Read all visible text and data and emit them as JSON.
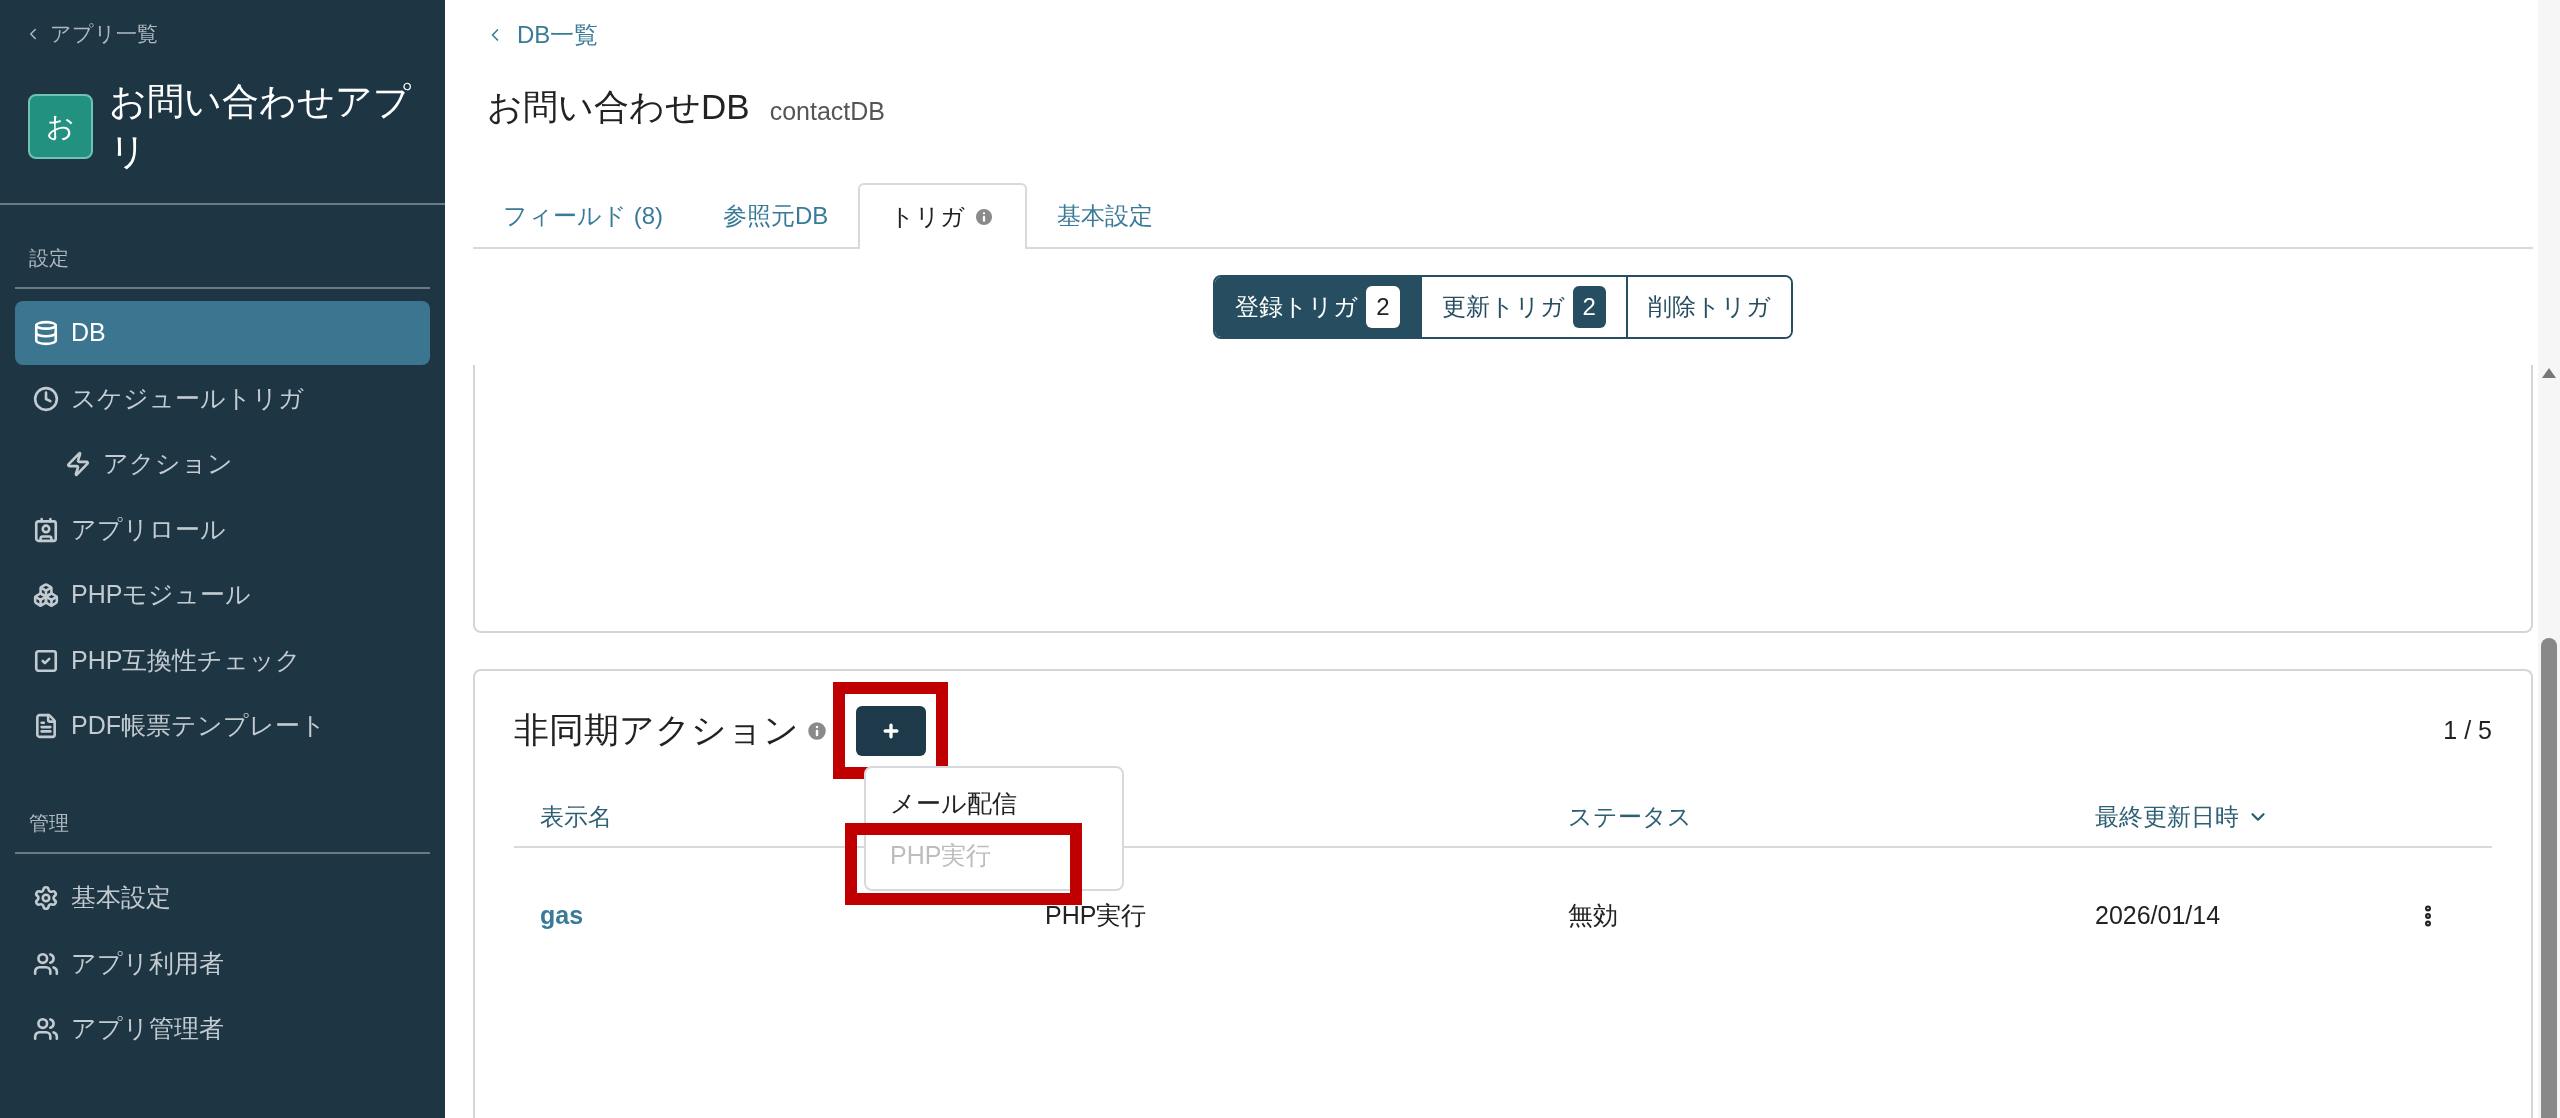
{
  "sidebar": {
    "back_link": "アプリ一覧",
    "app_initial": "お",
    "app_title": "お問い合わせアプリ",
    "sections": [
      {
        "heading": "設定",
        "items": [
          {
            "label": "DB",
            "selected": true
          },
          {
            "label": "スケジュールトリガ",
            "selected": false,
            "children": [
              {
                "label": "アクション",
                "selected": false
              }
            ]
          },
          {
            "label": "アプリロール",
            "selected": false
          },
          {
            "label": "PHPモジュール",
            "selected": false
          },
          {
            "label": "PHP互換性チェック",
            "selected": false
          },
          {
            "label": "PDF帳票テンプレート",
            "selected": false
          }
        ]
      },
      {
        "heading": "管理",
        "items": [
          {
            "label": "基本設定",
            "selected": false
          },
          {
            "label": "アプリ利用者",
            "selected": false
          },
          {
            "label": "アプリ管理者",
            "selected": false
          }
        ]
      }
    ]
  },
  "header": {
    "back_link": "DB一覧",
    "title": "お問い合わせDB",
    "subtitle": "contactDB"
  },
  "tabs": [
    {
      "label": "フィールド (8)",
      "selected": false,
      "info": false
    },
    {
      "label": "参照元DB",
      "selected": false,
      "info": false
    },
    {
      "label": "トリガ",
      "selected": true,
      "info": true
    },
    {
      "label": "基本設定",
      "selected": false,
      "info": false
    }
  ],
  "trigger_types": [
    {
      "label": "登録トリガ",
      "count": "2",
      "selected": true
    },
    {
      "label": "更新トリガ",
      "count": "2",
      "selected": false
    },
    {
      "label": "削除トリガ",
      "selected": false
    }
  ],
  "async_actions": {
    "title": "非同期アクション",
    "add_button": {
      "highlighted": true
    },
    "page_indicator": "1 / 5",
    "columns": [
      {
        "label": "表示名",
        "sorted": false
      },
      {},
      {
        "label": "ステータス",
        "sorted": false
      },
      {
        "label": "最終更新日時",
        "sorted": true
      }
    ],
    "rows": [
      {
        "cells": [
          "gas",
          "PHP実行",
          "無効",
          "2026/01/14"
        ]
      }
    ],
    "add_menu": [
      {
        "label": "メール配信",
        "disabled": false,
        "highlighted": false
      },
      {
        "label": "PHP実行",
        "disabled": true,
        "highlighted": true
      }
    ]
  }
}
